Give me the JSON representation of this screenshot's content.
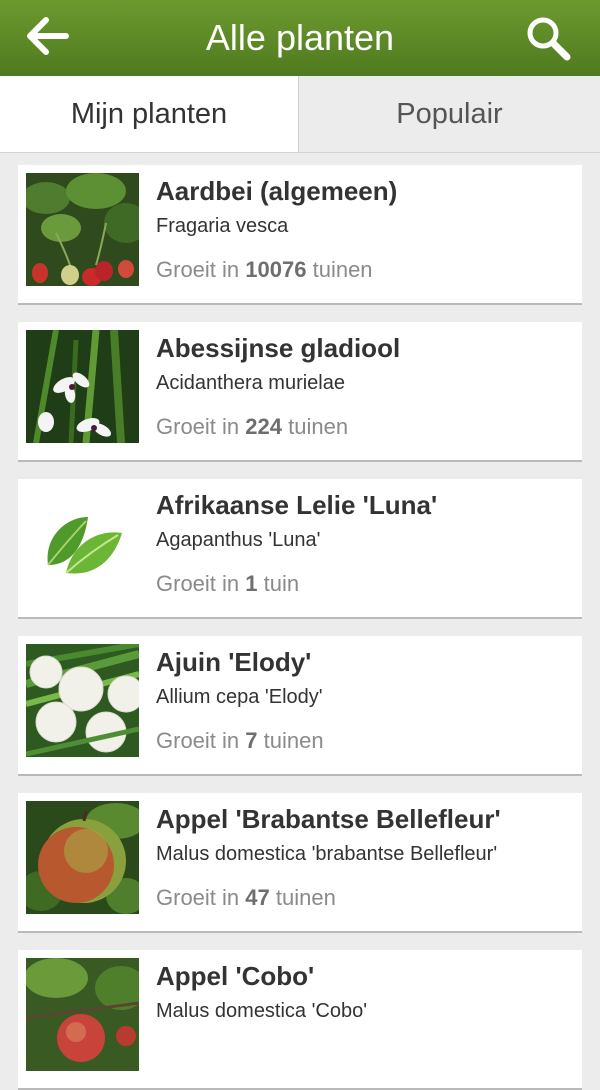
{
  "header": {
    "title": "Alle planten",
    "back_icon": "arrow-left-icon",
    "search_icon": "search-icon"
  },
  "tabs": [
    {
      "label": "Mijn planten",
      "active": true
    },
    {
      "label": "Populair",
      "active": false
    }
  ],
  "plants": [
    {
      "name": "Aardbei (algemeen)",
      "latin": "Fragaria vesca",
      "prefix": "Groeit in",
      "count": "10076",
      "suffix": "tuinen",
      "image": "strawberry"
    },
    {
      "name": "Abessijnse gladiool",
      "latin": "Acidanthera murielae",
      "prefix": "Groeit in",
      "count": "224",
      "suffix": "tuinen",
      "image": "gladiolus"
    },
    {
      "name": "Afrikaanse Lelie 'Luna'",
      "latin": "Agapanthus 'Luna'",
      "prefix": "Groeit in",
      "count": "1",
      "suffix": "tuin",
      "image": "leaf-icon"
    },
    {
      "name": "Ajuin 'Elody'",
      "latin": "Allium cepa 'Elody'",
      "prefix": "Groeit in",
      "count": "7",
      "suffix": "tuinen",
      "image": "onion"
    },
    {
      "name": "Appel 'Brabantse Bellefleur'",
      "latin": "Malus domestica 'brabantse Bellefleur'",
      "prefix": "Groeit in",
      "count": "47",
      "suffix": "tuinen",
      "image": "apple"
    },
    {
      "name": "Appel 'Cobo'",
      "latin": "Malus domestica 'Cobo'",
      "prefix": "",
      "count": "",
      "suffix": "",
      "image": "apple-tree"
    }
  ],
  "colors": {
    "header": "#5a8a25",
    "background": "#ececec",
    "card": "#ffffff"
  }
}
